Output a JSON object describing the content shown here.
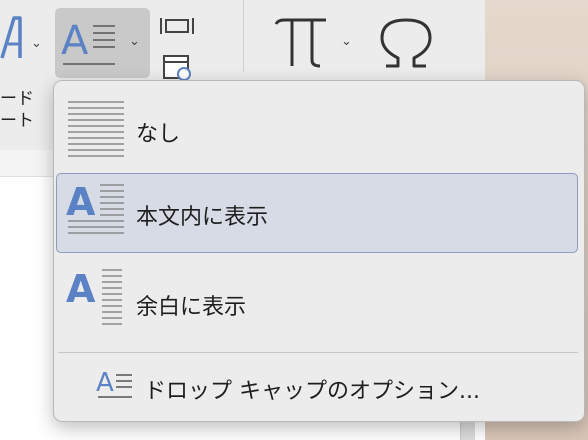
{
  "ribbon": {
    "textbox_label_line1": "ード",
    "textbox_label_line2": "ート"
  },
  "dropcap_menu": {
    "items": [
      {
        "label": "なし",
        "icon": "dropcap-none-icon",
        "selected": false
      },
      {
        "label": "本文内に表示",
        "icon": "dropcap-in-text-icon",
        "selected": true
      },
      {
        "label": "余白に表示",
        "icon": "dropcap-in-margin-icon",
        "selected": false
      }
    ],
    "options_label": "ドロップ キャップのオプション...",
    "options_icon": "dropcap-options-icon"
  },
  "icons": {
    "wordart": "wordart-icon",
    "dropcap": "dropcap-icon",
    "date_time": "date-time-icon",
    "equation": "pi-icon",
    "symbol": "omega-icon"
  },
  "colors": {
    "accent_letter": "#5b82c4",
    "selection_bg": "#d6dbe6",
    "selection_border": "#8d9dbe",
    "menu_bg": "#ececec"
  }
}
